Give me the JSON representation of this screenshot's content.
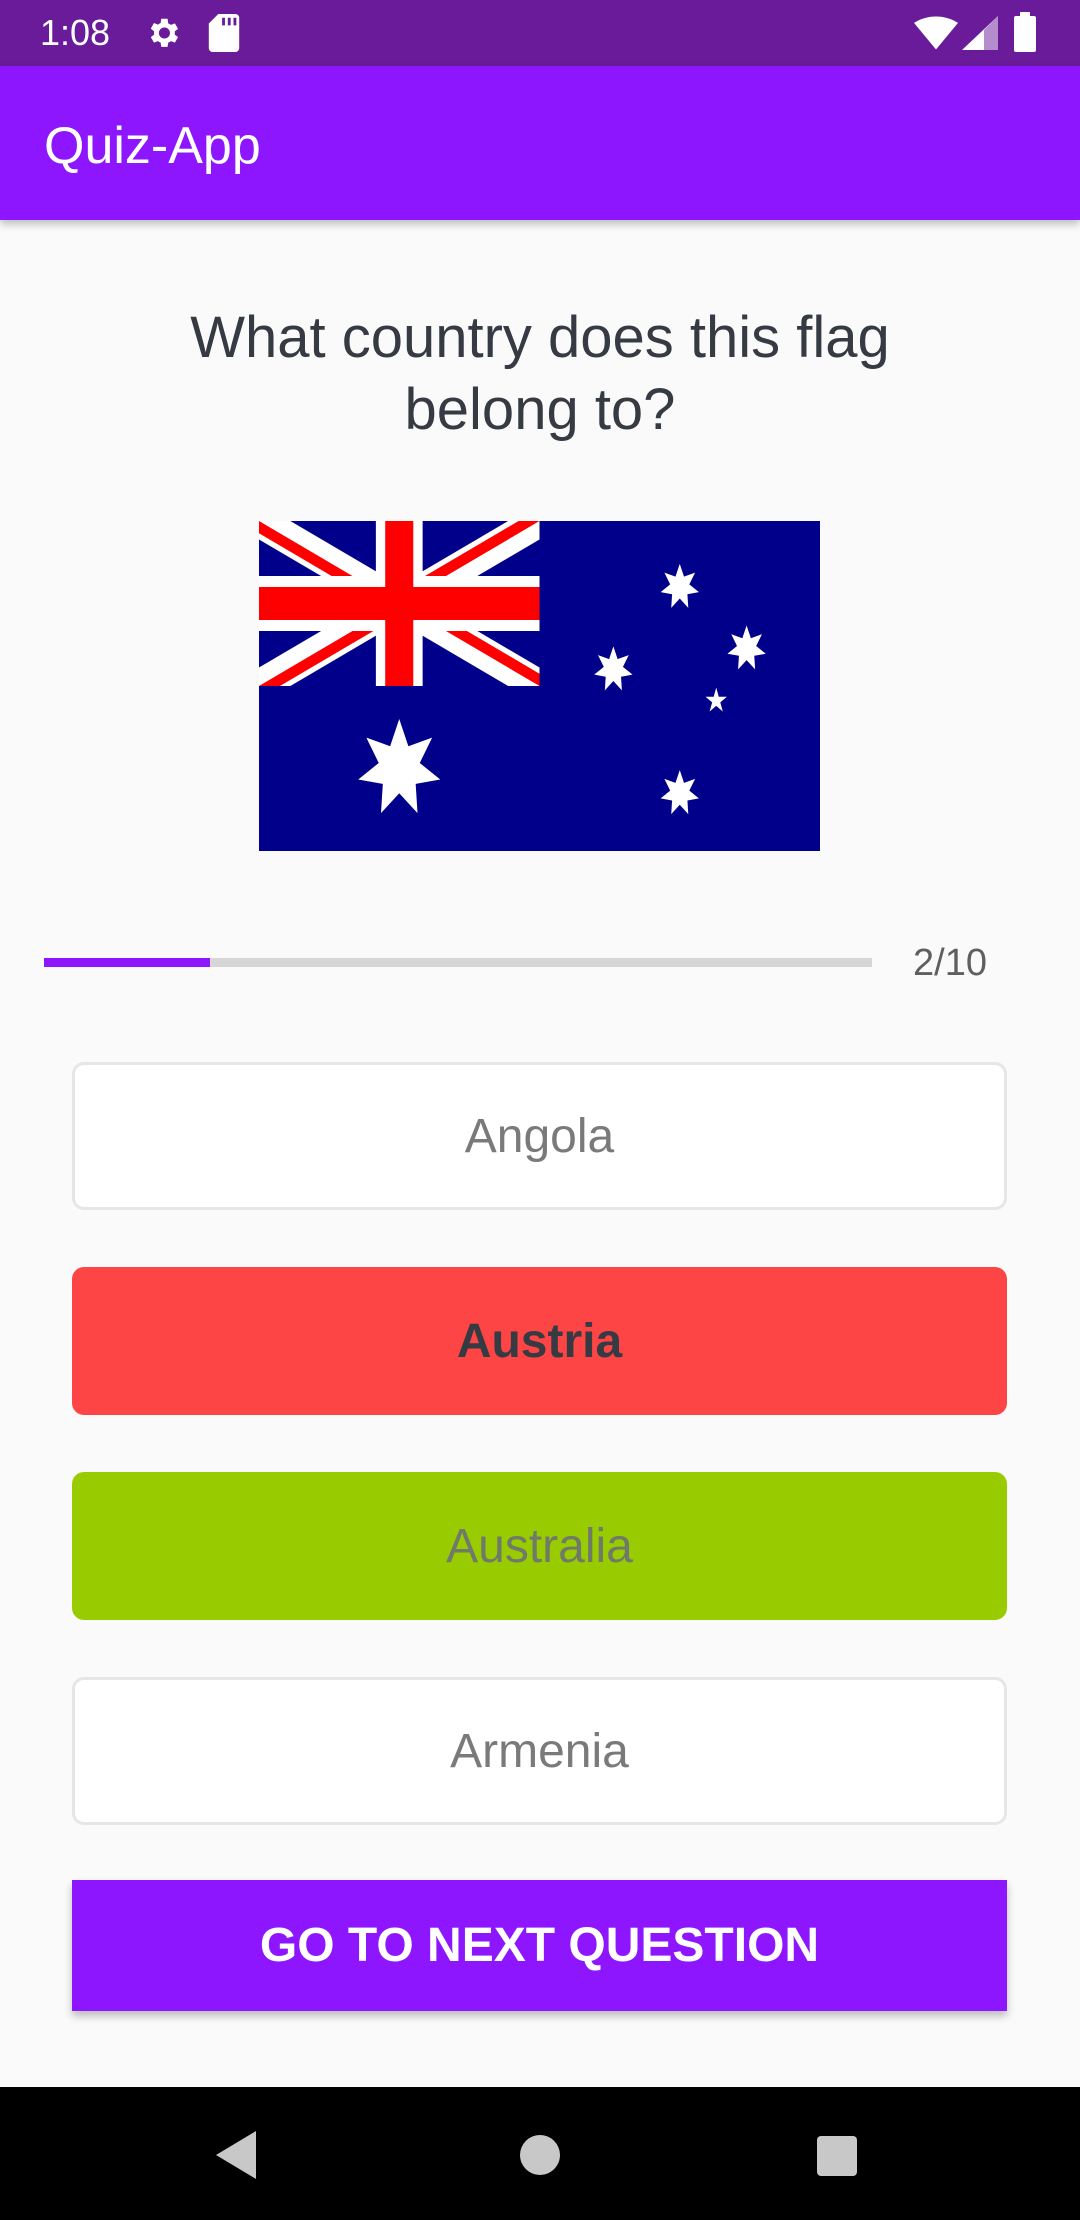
{
  "status_bar": {
    "time": "1:08",
    "icons": [
      "settings-icon",
      "sd-card-icon",
      "wifi-icon",
      "signal-icon",
      "battery-icon"
    ]
  },
  "app_bar": {
    "title": "Quiz-App"
  },
  "quiz": {
    "question": "What country does this flag belong to?",
    "flag_icon": "australia-flag",
    "progress": {
      "current": 2,
      "total": 10,
      "text": "2/10"
    },
    "options": [
      {
        "label": "Angola",
        "state": "default"
      },
      {
        "label": "Austria",
        "state": "wrong"
      },
      {
        "label": "Australia",
        "state": "correct"
      },
      {
        "label": "Armenia",
        "state": "default"
      }
    ],
    "submit_label": "GO TO NEXT QUESTION"
  },
  "colors": {
    "status_bar": "#6a1b9a",
    "primary": "#8e16ff",
    "wrong": "#fd4545",
    "correct": "#99cc00",
    "background": "#fafafa"
  },
  "nav_bar": {
    "icons": [
      "back-icon",
      "home-icon",
      "recents-icon"
    ]
  }
}
